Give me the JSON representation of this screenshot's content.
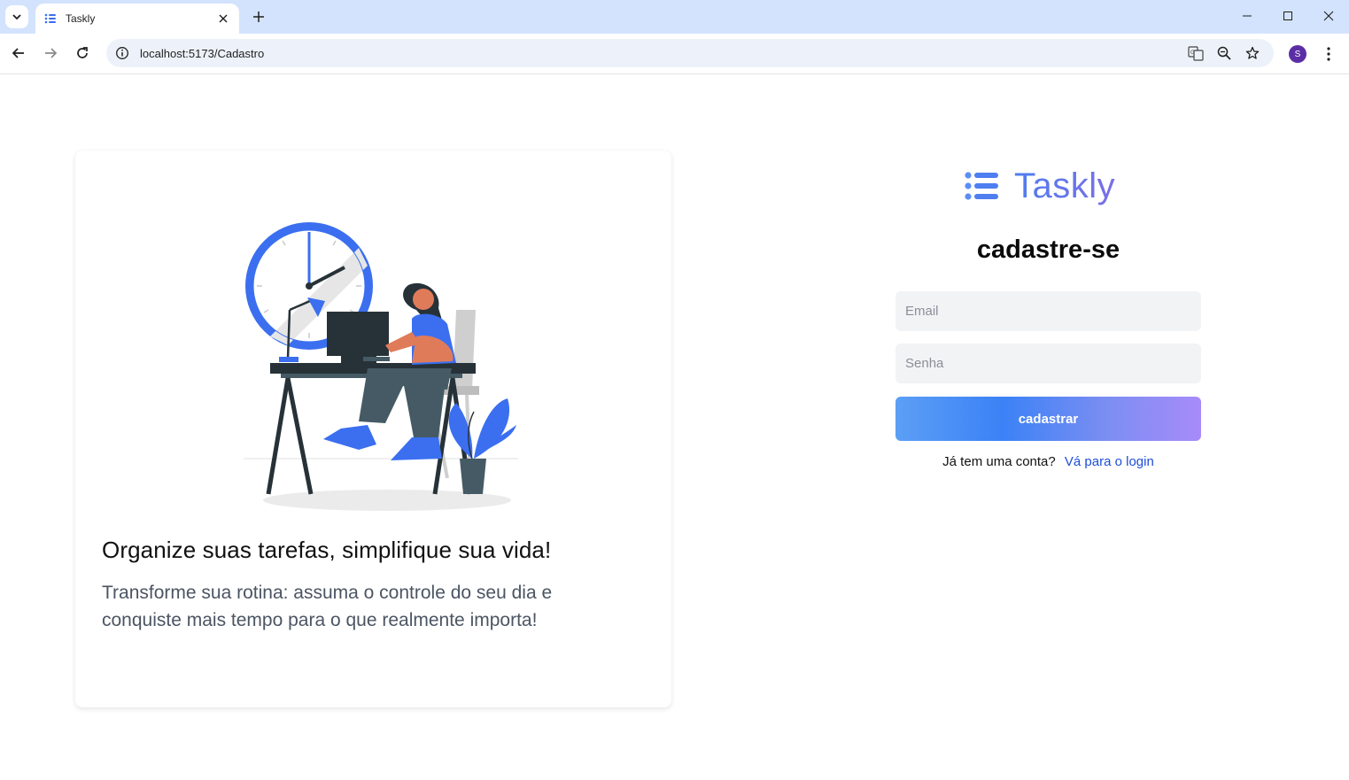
{
  "browser": {
    "tab_title": "Taskly",
    "url": "localhost:5173/Cadastro",
    "profile_initial": "S"
  },
  "card": {
    "title": "Organize suas tarefas, simplifique sua vida!",
    "subtitle": "Transforme sua rotina: assuma o controle do seu dia e conquiste mais tempo para o que realmente importa!"
  },
  "brand": {
    "name": "Taskly",
    "icon": "list-icon"
  },
  "form": {
    "title": "cadastre-se",
    "email_placeholder": "Email",
    "password_placeholder": "Senha",
    "submit_label": "cadastrar",
    "login_prompt": "Já tem uma conta?",
    "login_link": "Vá para o login"
  },
  "colors": {
    "accent_blue": "#3b82f6",
    "accent_purple": "#a78bfa",
    "link": "#1d4ed8",
    "field_bg": "#f2f3f5"
  }
}
